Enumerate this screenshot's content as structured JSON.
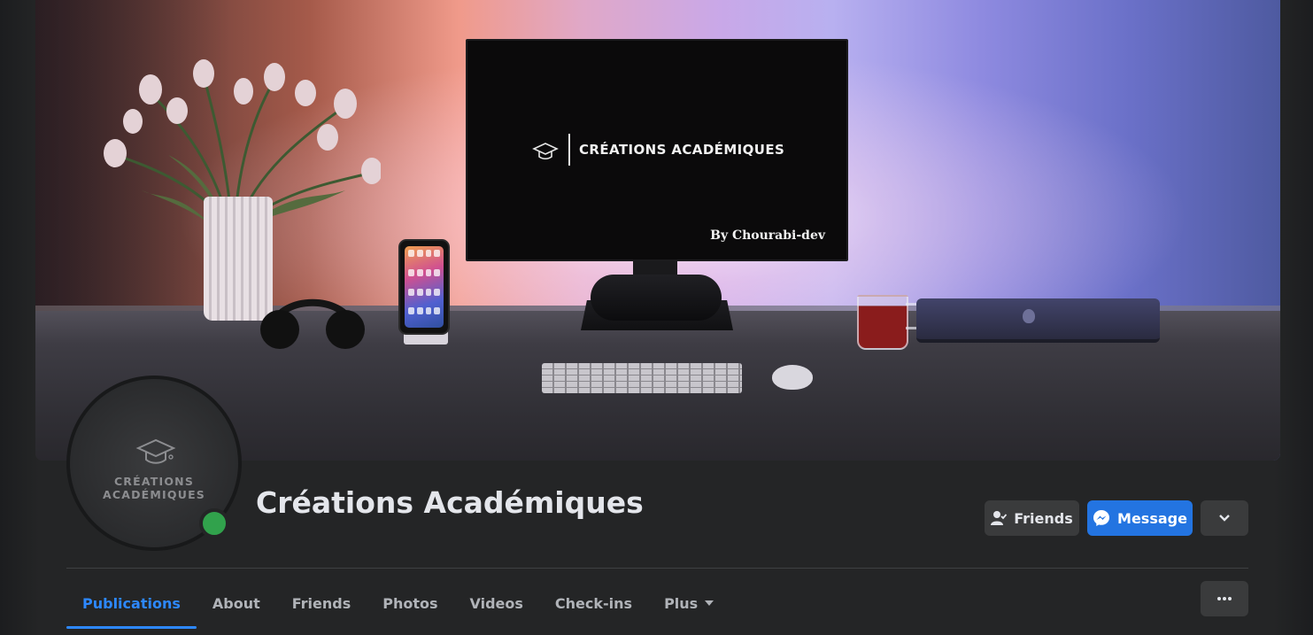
{
  "cover": {
    "monitor_brand": "CRÉATIONS ACADÉMIQUES",
    "monitor_byline": "By Chourabi-dev"
  },
  "avatar": {
    "brand": "CRÉATIONS ACADÉMIQUES",
    "online": true
  },
  "profile": {
    "name": "Créations Académiques"
  },
  "actions": {
    "friends_label": "Friends",
    "message_label": "Message"
  },
  "tabs": [
    {
      "label": "Publications",
      "active": true
    },
    {
      "label": "About"
    },
    {
      "label": "Friends"
    },
    {
      "label": "Photos"
    },
    {
      "label": "Videos"
    },
    {
      "label": "Check-ins"
    },
    {
      "label": "Plus"
    }
  ],
  "colors": {
    "accent": "#2d88ff",
    "message_button": "#2374e1",
    "online": "#31a24c",
    "button_bg": "#3a3b3c"
  },
  "icons": {
    "friends": "person-check-icon",
    "message": "messenger-icon",
    "more": "chevron-down-icon",
    "overflow": "three-dots-icon",
    "brand": "graduation-cap-icon"
  }
}
